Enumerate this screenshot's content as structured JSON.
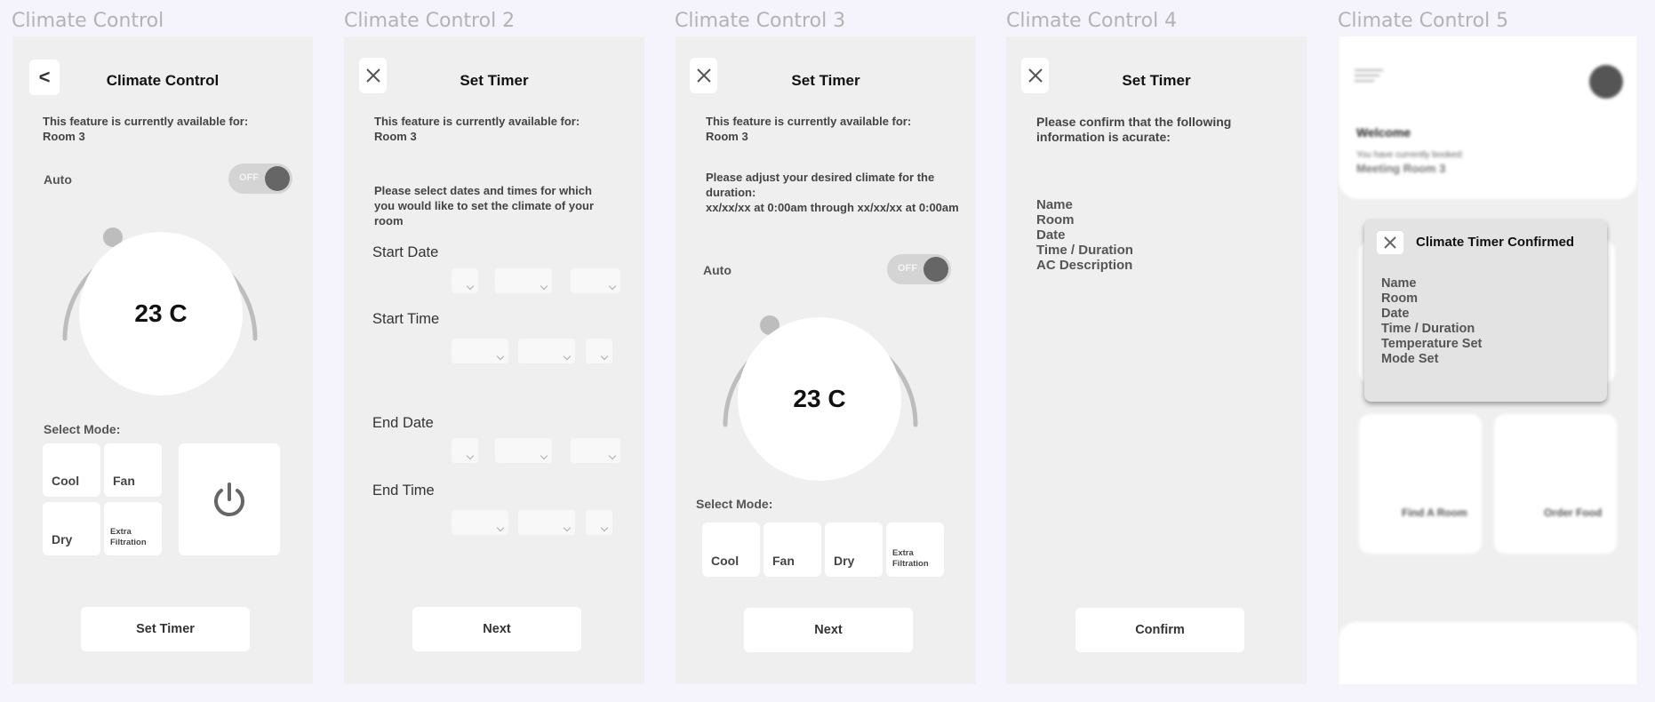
{
  "frames": {
    "f1": {
      "title": "Climate Control",
      "back_label": "<",
      "header": "Climate Control",
      "info_line1": "This feature is currently available for:",
      "info_line2": "Room 3",
      "auto_label": "Auto",
      "toggle_text": "OFF",
      "temperature": "23 C",
      "select_mode_label": "Select Mode:",
      "modes": [
        "Cool",
        "Fan",
        "Dry",
        "Extra Filtration"
      ],
      "power_icon": "power-icon",
      "button": "Set Timer"
    },
    "f2": {
      "title": "Climate Control 2",
      "header": "Set Timer",
      "info_line1": "This feature is currently available for:",
      "info_line2": "Room 3",
      "instructions": "Please select dates and times for which you would like to set the climate of your room",
      "start_date": "Start Date",
      "start_time": "Start Time",
      "end_date": "End Date",
      "end_time": "End Time",
      "button": "Next"
    },
    "f3": {
      "title": "Climate Control 3",
      "header": "Set Timer",
      "info_line1": "This feature is currently available for:",
      "info_line2": "Room 3",
      "adjust_line1": "Please adjust your desired climate for the duration:",
      "adjust_line2": "xx/xx/xx at 0:00am through xx/xx/xx at 0:00am",
      "auto_label": "Auto",
      "toggle_text": "OFF",
      "temperature": "23 C",
      "select_mode_label": "Select Mode:",
      "modes": [
        "Cool",
        "Fan",
        "Dry",
        "Extra Filtration"
      ],
      "button": "Next"
    },
    "f4": {
      "title": "Climate Control 4",
      "header": "Set Timer",
      "confirm_text": "Please confirm that the following information is acurate:",
      "fields": [
        "Name",
        "Room",
        "Date",
        "Time / Duration",
        "AC Description"
      ],
      "button": "Confirm"
    },
    "f5": {
      "title": "Climate Control 5",
      "welcome": "Welcome",
      "booked_text": "You have currently booked:",
      "booked_room": "Meeting Room 3",
      "modal_title": "Climate Timer Confirmed",
      "modal_fields": [
        "Name",
        "Room",
        "Date",
        "Time / Duration",
        "Temperature Set",
        "Mode Set"
      ],
      "tile_left": "Find A Room",
      "tile_right": "Order Food"
    }
  },
  "colors": {
    "page_bg": "#f5f3fc",
    "frame_bg": "#efefef",
    "card_bg": "#ffffff",
    "knob": "#666666",
    "arc": "#bdbdbd"
  }
}
